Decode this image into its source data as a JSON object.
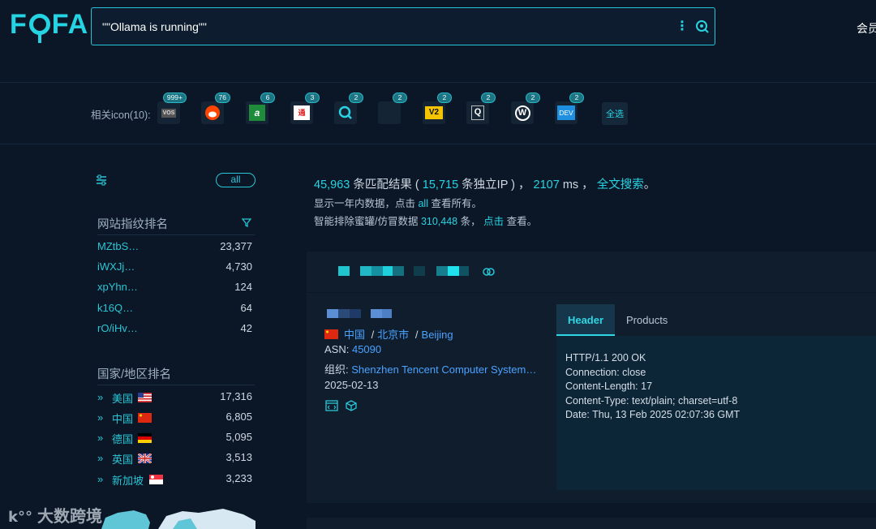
{
  "header": {
    "logo": "FOFA",
    "search_value": "\"\"Ollama is running\"\"",
    "member_label": "会员"
  },
  "iconbar": {
    "label": "相关icon(10):",
    "icons": [
      {
        "name": "vos-icon",
        "badge": "999+",
        "glyph": "VOS"
      },
      {
        "name": "reddit-icon",
        "badge": "76",
        "glyph": "●"
      },
      {
        "name": "a-letter-icon",
        "badge": "6",
        "glyph": "a"
      },
      {
        "name": "chinese-sign-icon",
        "badge": "3",
        "glyph": "通"
      },
      {
        "name": "q-search-icon",
        "badge": "2",
        "glyph": "Q"
      },
      {
        "name": "blank-icon",
        "badge": "2",
        "glyph": ""
      },
      {
        "name": "v2-icon",
        "badge": "2",
        "glyph": "V2"
      },
      {
        "name": "q-box-icon",
        "badge": "2",
        "glyph": "Q"
      },
      {
        "name": "wordpress-icon",
        "badge": "2",
        "glyph": "W"
      },
      {
        "name": "dev-icon",
        "badge": "2",
        "glyph": "DEV"
      }
    ],
    "select_all": "全选"
  },
  "sidebar": {
    "all_label": "all",
    "fingerprint_title": "网站指纹排名",
    "fingerprints": [
      {
        "name": "MZtbS…",
        "count": "23,377"
      },
      {
        "name": "iWXJj…",
        "count": "4,730"
      },
      {
        "name": "xpYhn…",
        "count": "124"
      },
      {
        "name": "k16Q…",
        "count": "64"
      },
      {
        "name": "rO/iHv…",
        "count": "42"
      }
    ],
    "country_title": "国家/地区排名",
    "countries": [
      {
        "name": "美国",
        "count": "17,316"
      },
      {
        "name": "中国",
        "count": "6,805"
      },
      {
        "name": "德国",
        "count": "5,095"
      },
      {
        "name": "英国",
        "count": "3,513"
      },
      {
        "name": "新加坡",
        "count": "3,233"
      }
    ]
  },
  "results": {
    "total": "45,963",
    "t1": " 条匹配结果 ( ",
    "unique_ip": "15,715",
    "t2": " 条独立IP ) ， ",
    "ms": "2107",
    "t3": " ms ， ",
    "fulltext": "全文搜索",
    "t4": "。",
    "line2a": "显示一年内数据，点击 ",
    "line2_link": "all",
    "line2b": " 查看所有。",
    "line3a": "智能排除蜜罐/仿冒数据 ",
    "honeypot": "310,448",
    "line3b": " 条， ",
    "line3_link": "点击",
    "line3c": " 查看。"
  },
  "card": {
    "country": "中国",
    "sep1": "/",
    "city": "北京市",
    "sep2": "/",
    "region": "Beijing",
    "asn_label": "ASN:",
    "asn": "45090",
    "org_label": "组织:",
    "org": "Shenzhen Tencent Computer System…",
    "date": "2025-02-13",
    "tab_header": "Header",
    "tab_products": "Products",
    "response": [
      "HTTP/1.1 200 OK",
      "Connection: close",
      "Content-Length: 17",
      "Content-Type: text/plain; charset=utf-8",
      "Date: Thu, 13 Feb 2025 02:07:36 GMT"
    ]
  },
  "watermark": "大数跨境",
  "colors": {
    "accent": "#29d3e2",
    "link": "#4aa3ff",
    "bg": "#0b1726"
  }
}
